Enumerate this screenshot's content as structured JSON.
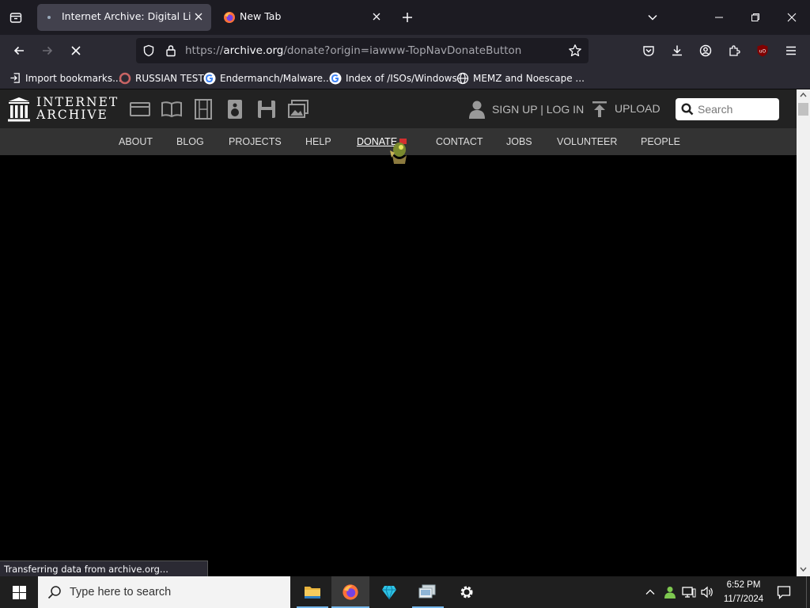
{
  "browser": {
    "tabs": [
      {
        "title": "Internet Archive: Digital Library",
        "active": true
      },
      {
        "title": "New Tab",
        "active": false
      }
    ],
    "url": {
      "scheme": "https://",
      "host": "archive.org",
      "path": "/donate?origin=iawww-TopNavDonateButton"
    },
    "bookmarks": [
      {
        "label": "Import bookmarks...",
        "icon": "import-icon"
      },
      {
        "label": "RUSSIAN TEST",
        "icon": "bookmark-favicon"
      },
      {
        "label": "Endermanch/Malware...",
        "icon": "google-icon"
      },
      {
        "label": "Index of /ISOs/Windows",
        "icon": "google-icon"
      },
      {
        "label": "MEMZ and Noescape ...",
        "icon": "globe-icon"
      }
    ],
    "status": "Transferring data from archive.org..."
  },
  "site": {
    "logo_line1": "INTERNET",
    "logo_line2": "ARCHIVE",
    "signup_login": "SIGN UP | LOG IN",
    "upload": "UPLOAD",
    "search_placeholder": "Search",
    "nav": [
      "ABOUT",
      "BLOG",
      "PROJECTS",
      "HELP",
      "DONATE",
      "CONTACT",
      "JOBS",
      "VOLUNTEER",
      "PEOPLE"
    ]
  },
  "taskbar": {
    "search_placeholder": "Type here to search",
    "time": "6:52 PM",
    "date": "11/7/2024"
  },
  "colors": {
    "tabstrip_bg": "#1c1b22",
    "toolbar_bg": "#2b2a33",
    "ia_header_bg": "#222222",
    "ia_subnav_bg": "#333333",
    "donate_badge": "#d32f2f"
  }
}
